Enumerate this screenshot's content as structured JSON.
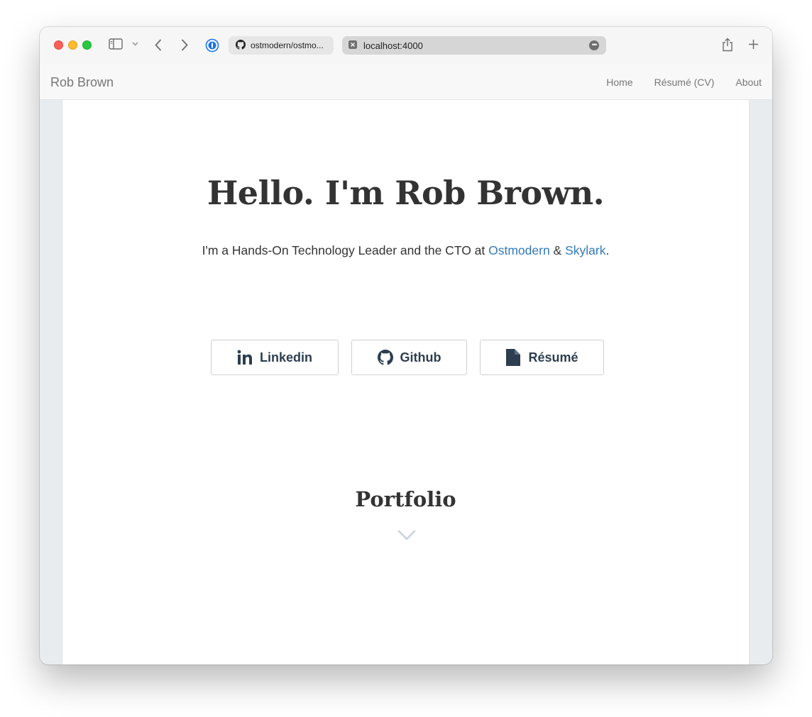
{
  "browser": {
    "tabs": [
      {
        "label": "ostmodern/ostmo..."
      },
      {
        "label": "localhost:4000"
      }
    ],
    "tab_more": "•••"
  },
  "site": {
    "brand": "Rob Brown",
    "nav": [
      "Home",
      "Résumé (CV)",
      "About"
    ]
  },
  "hero": {
    "title": "Hello. I'm Rob Brown.",
    "subtitle_prefix": "I'm a Hands-On Technology Leader and the CTO at ",
    "link1": "Ostmodern",
    "amp": " & ",
    "link2": "Skylark",
    "suffix": "."
  },
  "buttons": {
    "linkedin": "Linkedin",
    "github": "Github",
    "resume": "Résumé"
  },
  "portfolio": {
    "heading": "Portfolio"
  },
  "colors": {
    "link": "#337ab7",
    "button_text": "#2c3e50",
    "chevron": "#c8d3de"
  }
}
